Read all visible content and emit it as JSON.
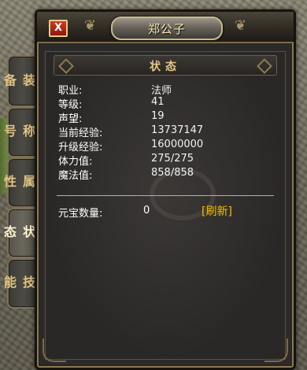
{
  "window": {
    "title": "郑公子",
    "close_label": "X"
  },
  "tabs": [
    {
      "label": "装备"
    },
    {
      "label": "称号"
    },
    {
      "label": "属性"
    },
    {
      "label": "状态"
    },
    {
      "label": "技能"
    }
  ],
  "active_tab": 3,
  "section": {
    "title": "状态"
  },
  "stats": [
    {
      "label": "职业:",
      "value": "法师"
    },
    {
      "label": "等级:",
      "value": "41"
    },
    {
      "label": "声望:",
      "value": "19"
    },
    {
      "label": "当前经验:",
      "value": "13737147"
    },
    {
      "label": "升级经验:",
      "value": "16000000"
    },
    {
      "label": "体力值:",
      "value": "275/275"
    },
    {
      "label": "魔法值:",
      "value": "858/858"
    }
  ],
  "yuanbao": {
    "label": "元宝数量:",
    "value": "0",
    "refresh_label": "[刷新]"
  },
  "colors": {
    "accent_gold": "#f2c000",
    "frame": "#8c7a55",
    "tab_text": "#e0c384"
  }
}
